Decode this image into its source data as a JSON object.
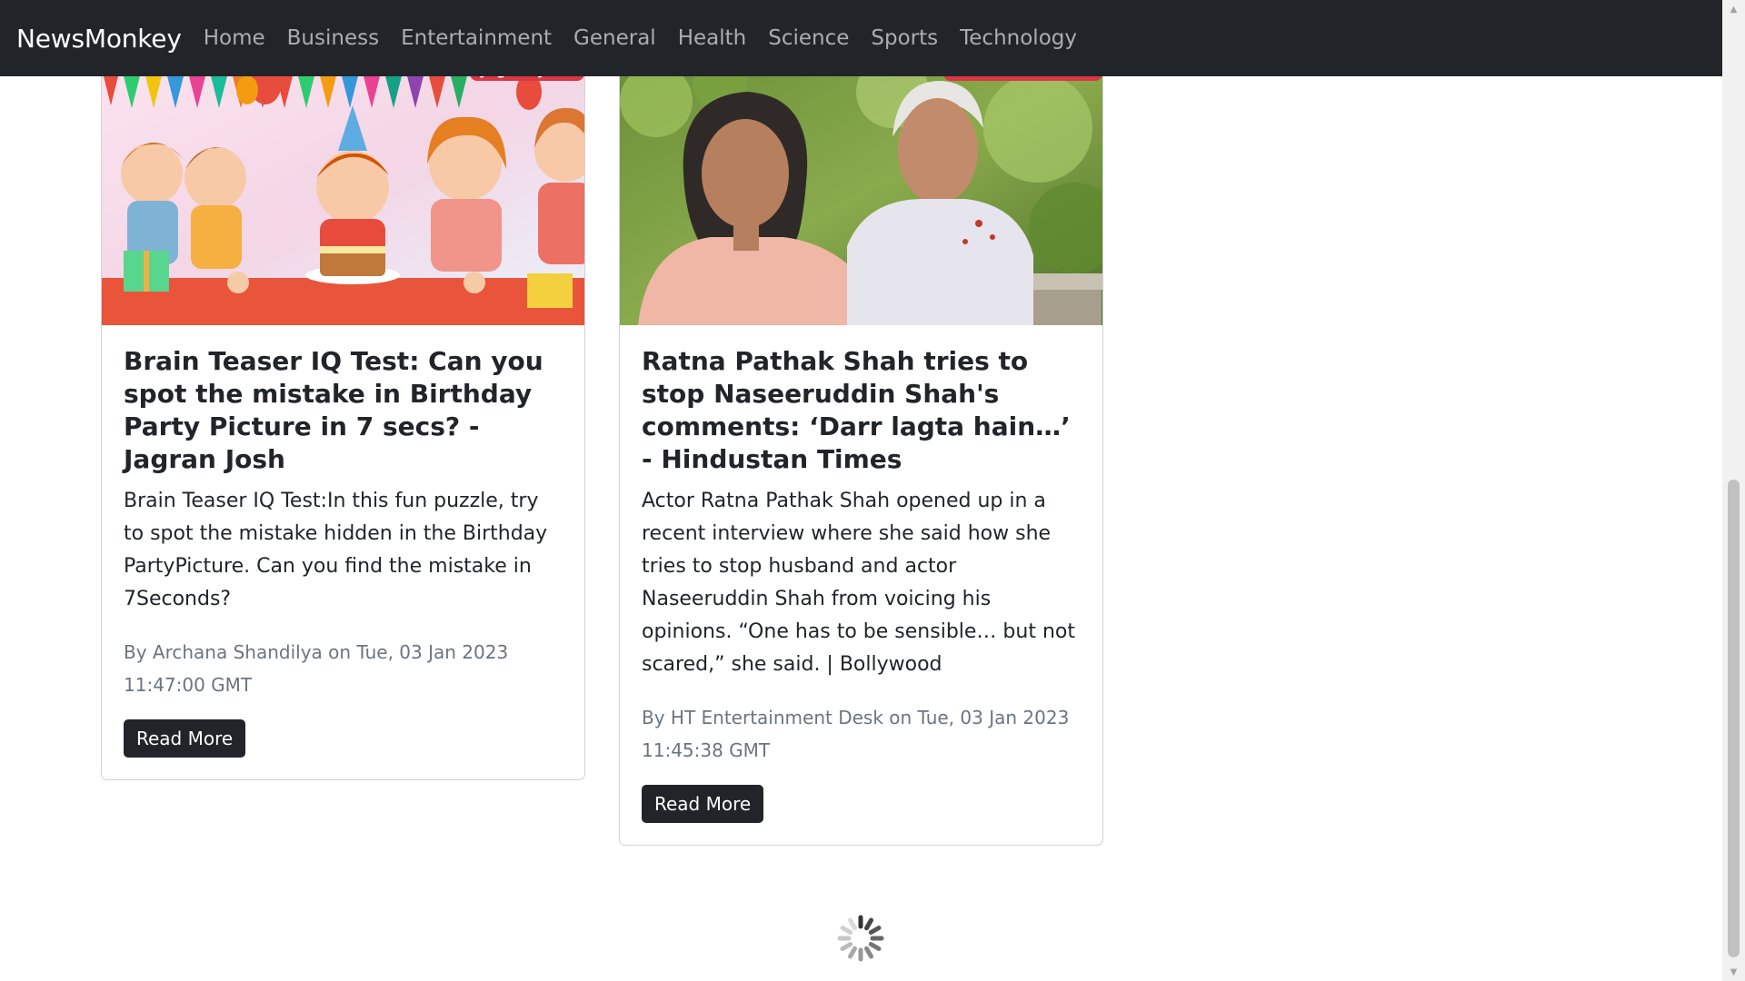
{
  "navbar": {
    "brand": "NewsMonkey",
    "links": [
      "Home",
      "Business",
      "Entertainment",
      "General",
      "Health",
      "Science",
      "Sports",
      "Technology"
    ]
  },
  "articles": [
    {
      "source": "Jagran Josh",
      "title": "Brain Teaser IQ Test: Can you spot the mistake in Birthday Party Picture in 7 secs? - Jagran Josh",
      "description": "Brain Teaser IQ Test:In this fun puzzle, try to spot the mistake hidden in the Birthday PartyPicture. Can you find the mistake in 7Seconds?",
      "meta": "By Archana Shandilya on Tue, 03 Jan 2023 11:47:00 GMT",
      "button": "Read More"
    },
    {
      "source": "Hindustan Times",
      "title": "Ratna Pathak Shah tries to stop Naseeruddin Shah's comments: ‘Darr lagta hain…’ - Hindustan Times",
      "description": "Actor Ratna Pathak Shah opened up in a recent interview where she said how she tries to stop husband and actor Naseeruddin Shah from voicing his opinions. “One has to be sensible… but not scared,” she said. | Bollywood",
      "meta": "By HT Entertainment Desk on Tue, 03 Jan 2023 11:45:38 GMT",
      "button": "Read More"
    }
  ],
  "colors": {
    "navbar_bg": "#212529",
    "badge_bg": "#dc3545",
    "button_bg": "#212529"
  }
}
